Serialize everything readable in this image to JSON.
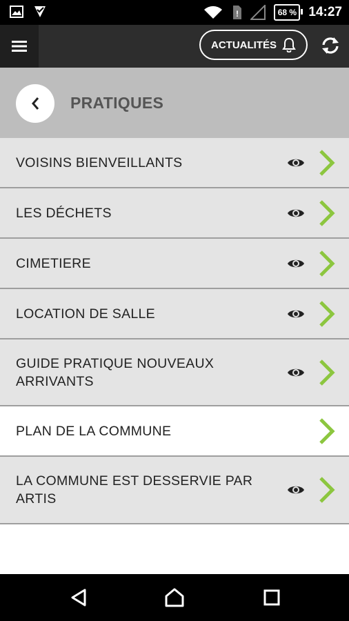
{
  "status_bar": {
    "time": "14:27",
    "battery": "68 %",
    "icons": [
      "image-icon",
      "notification-check-icon",
      "wifi-icon",
      "sim-icon",
      "signal-icon",
      "battery-icon"
    ]
  },
  "app_bar": {
    "menu_icon": "hamburger-menu-icon",
    "news_label": "ACTUALITÉS",
    "news_icon": "bell-icon",
    "refresh_icon": "refresh-icon"
  },
  "title_bar": {
    "back_icon": "chevron-left-icon",
    "title": "PRATIQUES"
  },
  "list": {
    "items": [
      {
        "label": "VOISINS BIENVEILLANTS",
        "has_eye": true,
        "white": false
      },
      {
        "label": "LES DÉCHETS",
        "has_eye": true,
        "white": false
      },
      {
        "label": "CIMETIERE",
        "has_eye": true,
        "white": false
      },
      {
        "label": "LOCATION DE SALLE",
        "has_eye": true,
        "white": false
      },
      {
        "label": "GUIDE PRATIQUE NOUVEAUX ARRIVANTS",
        "has_eye": true,
        "white": false
      },
      {
        "label": "PLAN DE LA COMMUNE",
        "has_eye": false,
        "white": true
      },
      {
        "label": "LA COMMUNE EST DESSERVIE PAR ARTIS",
        "has_eye": true,
        "white": false
      }
    ]
  },
  "colors": {
    "accent_green": "#8cc63f",
    "appbar": "#2d2d2d",
    "titlebar": "#bdbdbd",
    "item_bg": "#e4e4e4"
  },
  "nav_bar": {
    "icons": [
      "back-triangle-icon",
      "home-icon",
      "recents-square-icon"
    ]
  }
}
